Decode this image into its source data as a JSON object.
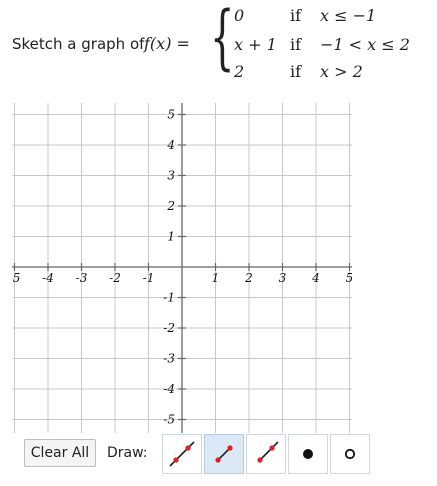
{
  "prompt": {
    "text": "Sketch a graph of",
    "function_lhs": "f(x) =",
    "cases": [
      {
        "value": "0",
        "if": "if",
        "condition": "x ≤ −1"
      },
      {
        "value": "x + 1",
        "if": "if",
        "condition": "−1 < x ≤ 2"
      },
      {
        "value": "2",
        "if": "if",
        "condition": "x > 2"
      }
    ]
  },
  "graph": {
    "x_ticks": [
      "-5",
      "-4",
      "-3",
      "-2",
      "-1",
      "1",
      "2",
      "3",
      "4",
      "5"
    ],
    "y_ticks": [
      "5",
      "4",
      "3",
      "2",
      "1",
      "-1",
      "-2",
      "-3",
      "-4",
      "-5"
    ],
    "xlim": [
      -5,
      5
    ],
    "ylim": [
      -5,
      5
    ],
    "grid": true,
    "grid_color": "#c8c8c8",
    "axis_color": "#666666"
  },
  "toolbar": {
    "clear_label": "Clear All",
    "draw_label": "Draw:",
    "tools": [
      {
        "name": "line-tool",
        "icon": "line-icon",
        "active": false
      },
      {
        "name": "segment-tool",
        "icon": "segment-icon",
        "active": true
      },
      {
        "name": "ray-tool",
        "icon": "ray-icon",
        "active": false
      },
      {
        "name": "closed-dot-tool",
        "icon": "closed-dot-icon",
        "active": false
      },
      {
        "name": "open-dot-tool",
        "icon": "open-dot-icon",
        "active": false
      }
    ],
    "accent_color": "#e02020",
    "active_color": "#dbe9f6"
  }
}
